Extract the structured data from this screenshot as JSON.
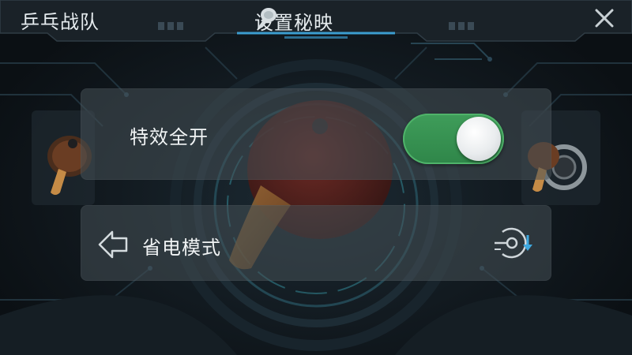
{
  "header": {
    "team_title": "乒乓战队",
    "settings_title": "设置秘映"
  },
  "settings": {
    "effects_label": "特效全开",
    "effects_enabled": true,
    "power_save_label": "省电模式"
  },
  "icons": {
    "settings": "paddle-icon",
    "close": "close-icon",
    "back": "back-arrow-icon",
    "power_mode": "target-download-icon"
  },
  "colors": {
    "toggle_on": "#3f9d5a",
    "accent_blue": "#3fa9e0",
    "text": "#e6ecef"
  }
}
